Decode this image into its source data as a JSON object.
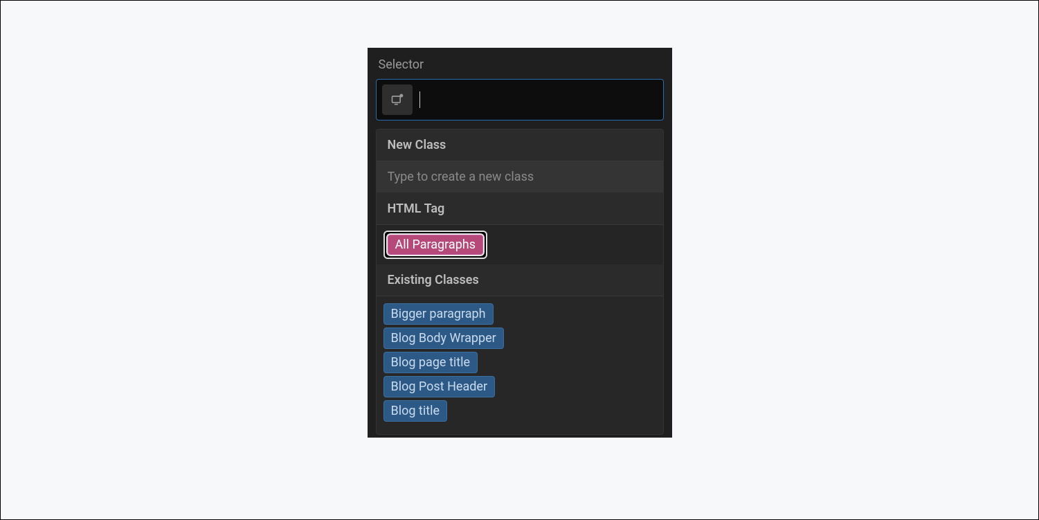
{
  "panel": {
    "title": "Selector",
    "input_value": "",
    "input_placeholder": ""
  },
  "sections": {
    "new_class": {
      "header": "New Class",
      "hint": "Type to create a new class"
    },
    "html_tag": {
      "header": "HTML Tag",
      "tag": "All Paragraphs"
    },
    "existing": {
      "header": "Existing Classes",
      "items": [
        "Bigger paragraph",
        "Blog Body Wrapper",
        "Blog page title",
        "Blog Post Header",
        "Blog title"
      ]
    }
  }
}
